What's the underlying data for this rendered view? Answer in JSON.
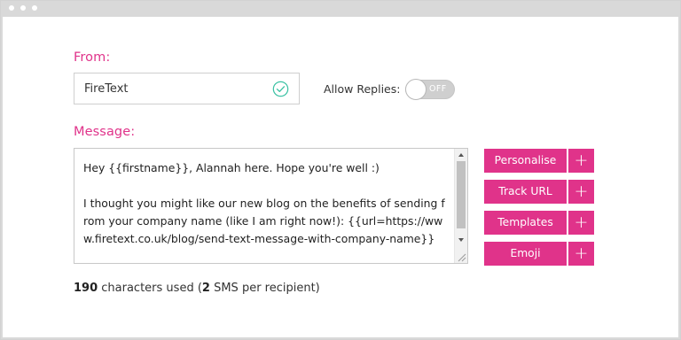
{
  "from": {
    "label": "From:",
    "value": "FireText",
    "status_icon": "check-circle-icon"
  },
  "allow_replies": {
    "label": "Allow Replies:",
    "state": "OFF"
  },
  "message": {
    "label": "Message:",
    "text": "Hey {{firstname}}, Alannah here. Hope you're well :)\n\nI thought you might like our new blog on the benefits of sending from your company name (like I am right now!): {{url=https://www.firetext.co.uk/blog/send-text-message-with-company-name}}"
  },
  "actions": [
    {
      "label": "Personalise",
      "icon": "plus-icon"
    },
    {
      "label": "Track URL",
      "icon": "plus-icon"
    },
    {
      "label": "Templates",
      "icon": "plus-icon"
    },
    {
      "label": "Emoji",
      "icon": "plus-icon"
    }
  ],
  "stats": {
    "characters": "190",
    "characters_text": " characters used (",
    "sms": "2",
    "sms_text": " SMS per recipient)"
  },
  "colors": {
    "accent": "#e0338a",
    "check": "#3cc2a4"
  }
}
